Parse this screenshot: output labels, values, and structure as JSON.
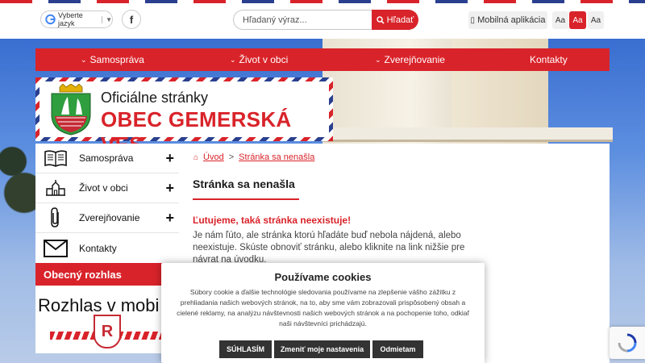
{
  "topbar": {
    "language_label": "Vyberte jazyk",
    "facebook_label": "f",
    "search_placeholder": "Hľadaný výraz...",
    "search_button": "Hľadať",
    "mobile_app": "Mobilná aplikácia",
    "font_sizes": [
      "Aa",
      "Aa",
      "Aa"
    ]
  },
  "nav": {
    "items": [
      "Samospráva",
      "Život v obci",
      "Zverejňovanie",
      "Kontakty"
    ]
  },
  "logo": {
    "subtitle": "Oficiálne stránky",
    "title": "OBEC GEMERSKÁ VES"
  },
  "sidebar": {
    "items": [
      {
        "label": "Samospráva",
        "icon": "book-icon",
        "expand": "+"
      },
      {
        "label": "Život v obci",
        "icon": "town-hall-icon",
        "expand": "+"
      },
      {
        "label": "Zverejňovanie",
        "icon": "paperclip-icon",
        "expand": "+"
      },
      {
        "label": "Kontakty",
        "icon": "envelope-icon"
      }
    ],
    "rozhlas_heading": "Obecný rozhlas",
    "rozhlas_text": "Rozhlas v mobi",
    "rozhlas_logo_letter": "R"
  },
  "breadcrumb": {
    "home": "Úvod",
    "separator": ">",
    "current": "Stránka sa nenašla"
  },
  "content": {
    "title": "Stránka sa nenašla",
    "error_title": "Ľutujeme, taká stránka neexistuje!",
    "error_text": "Je nám ľúto, ale stránka ktorú hľadáte buď nebola nájdená, alebo neexistuje. Skúste obnoviť stránku, alebo kliknite na link nižšie pre návrat na úvodku."
  },
  "cookie": {
    "title": "Používame cookies",
    "text": "Súbory cookie a ďalšie technológie sledovania používame na zlepšenie vášho zážitku z prehliadania našich webových stránok, na to, aby sme vám zobrazovali prispôsobený obsah a cielené reklamy, na analýzu návštevnosti našich webových stránok a na pochopenie toho, odkiaľ naši návštevníci prichádzajú.",
    "accept": "SÚHLASÍM",
    "settings": "Zmeniť moje nastavenia",
    "decline": "Odmietam"
  },
  "colors": {
    "accent": "#d9232a",
    "blue": "#2a3f8f",
    "dark_button": "#333333"
  }
}
